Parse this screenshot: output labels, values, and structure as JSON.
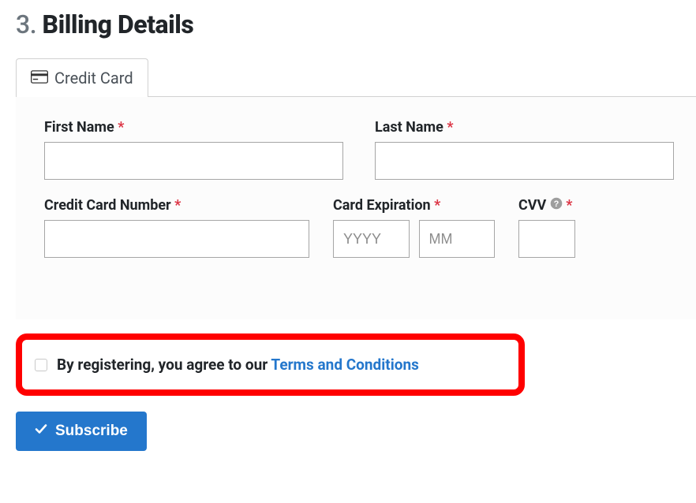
{
  "section": {
    "step_number": "3.",
    "title": "Billing Details"
  },
  "tab": {
    "label": "Credit Card"
  },
  "fields": {
    "first_name": {
      "label": "First Name",
      "required": "*"
    },
    "last_name": {
      "label": "Last Name",
      "required": "*"
    },
    "cc_number": {
      "label": "Credit Card Number",
      "required": "*"
    },
    "card_expiration": {
      "label": "Card Expiration",
      "required": "*",
      "year_placeholder": "YYYY",
      "month_placeholder": "MM"
    },
    "cvv": {
      "label": "CVV",
      "required": "*"
    }
  },
  "terms": {
    "prefix": "By registering, you agree to our ",
    "link_text": "Terms and Conditions"
  },
  "actions": {
    "subscribe_label": "Subscribe"
  }
}
